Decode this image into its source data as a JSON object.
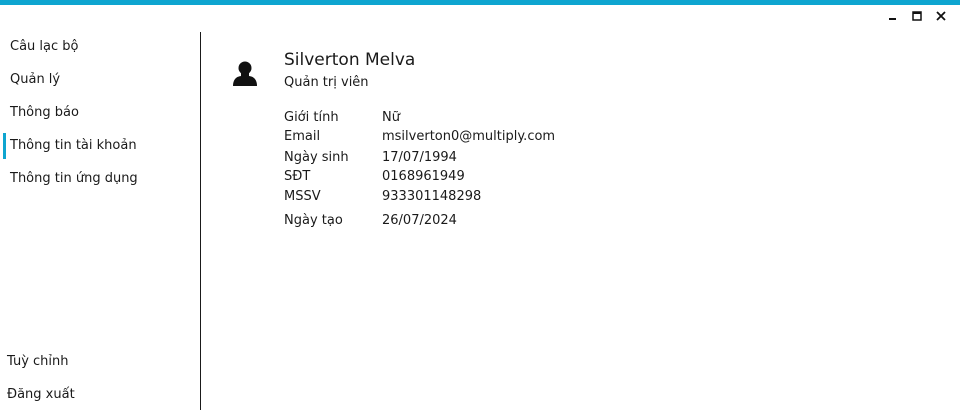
{
  "colors": {
    "accent": "#0ea5d0"
  },
  "window_controls": {
    "minimize_icon": "minimize-icon",
    "maximize_icon": "maximize-icon",
    "close_icon": "close-icon"
  },
  "sidebar": {
    "items": [
      {
        "label": "Câu lạc bộ"
      },
      {
        "label": "Quản lý"
      },
      {
        "label": "Thông báo"
      },
      {
        "label": "Thông tin tài khoản",
        "active": true
      },
      {
        "label": "Thông tin ứng dụng"
      }
    ],
    "bottom_items": [
      {
        "label": "Tuỳ chỉnh"
      },
      {
        "label": "Đăng xuất"
      }
    ]
  },
  "profile": {
    "avatar_icon": "user-silhouette-icon",
    "name": "Silverton Melva",
    "role": "Quản trị viên",
    "fields": [
      {
        "label": "Giới tính",
        "value": "Nữ"
      },
      {
        "label": "Email",
        "value": "msilverton0@multiply.com"
      },
      {
        "label": "Ngày sinh",
        "value": "17/07/1994"
      },
      {
        "label": "SĐT",
        "value": "0168961949"
      },
      {
        "label": "MSSV",
        "value": "933301148298"
      },
      {
        "label": "Ngày tạo",
        "value": "26/07/2024"
      }
    ]
  }
}
